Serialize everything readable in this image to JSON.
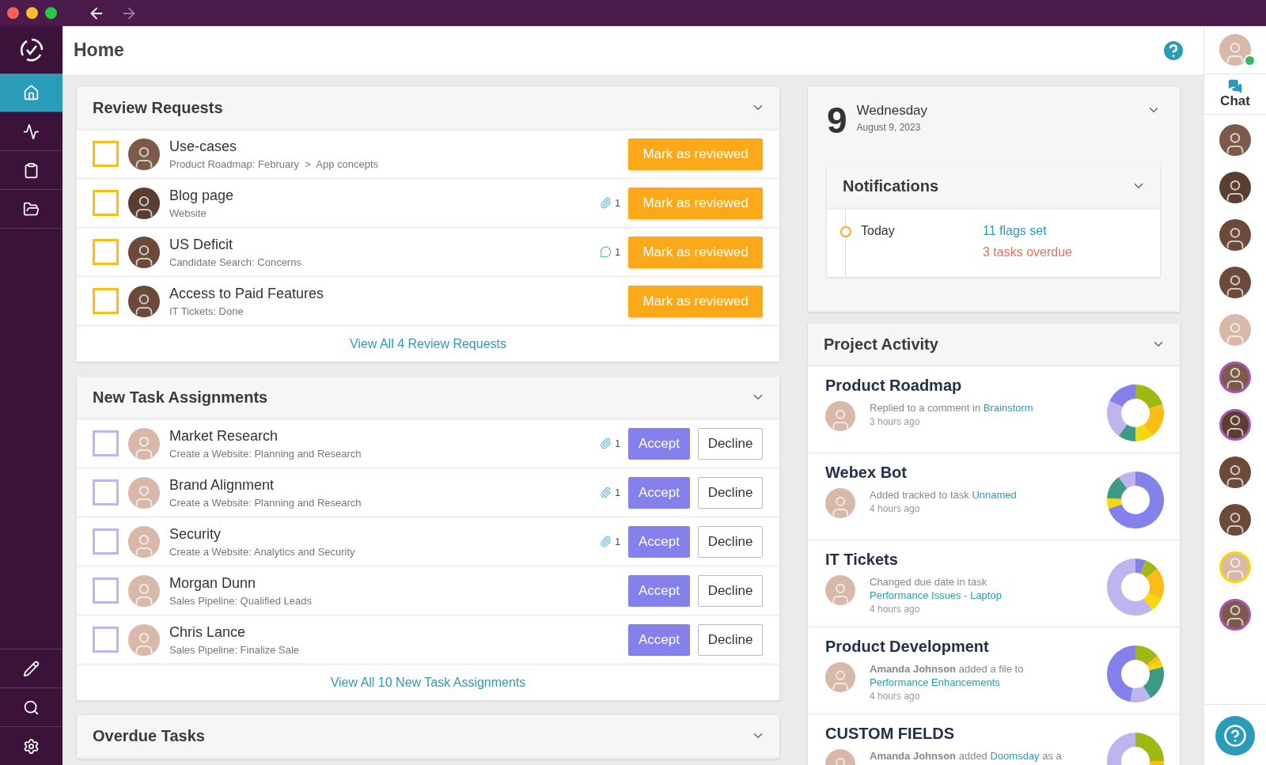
{
  "page": {
    "title": "Home"
  },
  "sidebar": {
    "items": [
      {
        "selected": true
      },
      {
        "selected": false
      },
      {
        "selected": false
      },
      {
        "selected": false
      }
    ]
  },
  "review_requests": {
    "title": "Review Requests",
    "expanded": true,
    "rows": [
      {
        "title": "Use-cases",
        "subtitle": "Product Roadmap: February  >  App concepts",
        "checked": false,
        "button": "Mark as reviewed"
      },
      {
        "title": "Blog page",
        "subtitle": "Website",
        "checked": false,
        "indicator": {
          "kind": "attachment",
          "count": "1"
        },
        "button": "Mark as reviewed"
      },
      {
        "title": "US Deficit",
        "subtitle": "Candidate Search: Concerns",
        "checked": false,
        "indicator": {
          "kind": "comment",
          "count": "1"
        },
        "button": "Mark as reviewed"
      },
      {
        "title": "Access to Paid Features",
        "subtitle": "IT Tickets: Done",
        "checked": false,
        "button": "Mark as reviewed"
      }
    ],
    "footer_link": "View All 4 Review Requests"
  },
  "task_assignments": {
    "title": "New Task Assignments",
    "expanded": true,
    "rows": [
      {
        "title": "Market Research",
        "subtitle": "Create a Website: Planning and Research",
        "checked": false,
        "indicator": {
          "kind": "attachment",
          "count": "1"
        },
        "accept": "Accept",
        "decline": "Decline"
      },
      {
        "title": "Brand Alignment",
        "subtitle": "Create a Website: Planning and Research",
        "checked": false,
        "indicator": {
          "kind": "attachment",
          "count": "1"
        },
        "accept": "Accept",
        "decline": "Decline"
      },
      {
        "title": "Security",
        "subtitle": "Create a Website: Analytics and Security",
        "checked": false,
        "indicator": {
          "kind": "attachment",
          "count": "1"
        },
        "accept": "Accept",
        "decline": "Decline"
      },
      {
        "title": "Morgan Dunn",
        "subtitle": "Sales Pipeline: Qualified Leads",
        "checked": false,
        "accept": "Accept",
        "decline": "Decline"
      },
      {
        "title": "Chris Lance",
        "subtitle": "Sales Pipeline: Finalize Sale",
        "checked": false,
        "accept": "Accept",
        "decline": "Decline"
      }
    ],
    "footer_link": "View All 10 New Task Assignments"
  },
  "overdue_tasks": {
    "title": "Overdue Tasks",
    "expanded": true
  },
  "date_card": {
    "day": "9",
    "weekday": "Wednesday",
    "date": "August 9, 2023",
    "expanded": true
  },
  "notifications": {
    "title": "Notifications",
    "expanded": true,
    "entries": [
      {
        "label": "Today",
        "items": [
          {
            "text": "11 flags set",
            "color": "#2a9bb8"
          },
          {
            "text": "3 tasks overdue",
            "color": "#e5705a"
          }
        ]
      }
    ]
  },
  "project_activity": {
    "title": "Project Activity",
    "expanded": true,
    "items": [
      {
        "project": "Product Roadmap",
        "action": "Replied to a comment in",
        "link": "Brainstorm",
        "time": "3 hours ago"
      },
      {
        "project": "Webex Bot",
        "action": "Added tracked to task",
        "link": "Unnamed",
        "time": "4 hours ago"
      },
      {
        "project": "IT Tickets",
        "action": "Changed due date in task",
        "link": "Performance Issues - Laptop",
        "time": "4 hours ago"
      },
      {
        "project": "Product Development",
        "actor": "Amanda Johnson",
        "action": "added a file to",
        "link": "Performance Enhancements",
        "time": "4 hours ago"
      },
      {
        "project": "CUSTOM FIELDS",
        "actor": "Amanda Johnson",
        "action": "added",
        "link": "Doomsday",
        "suffix": "as a"
      }
    ]
  },
  "chat": {
    "label": "Chat",
    "user_online": true,
    "contacts": [
      {
        "ringed": false
      },
      {
        "ringed": false
      },
      {
        "ringed": false
      },
      {
        "ringed": false
      },
      {
        "ringed": false
      },
      {
        "ringed": true,
        "color": "#a855b5"
      },
      {
        "ringed": true,
        "color": "#a855b5"
      },
      {
        "ringed": false
      },
      {
        "ringed": false
      },
      {
        "ringed": true,
        "color": "#f5d90a"
      },
      {
        "ringed": true,
        "color": "#a855b5"
      }
    ]
  }
}
